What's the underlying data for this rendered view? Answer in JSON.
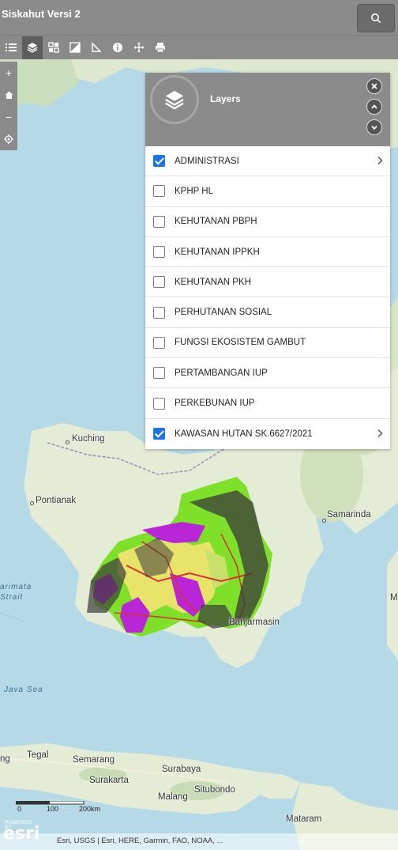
{
  "header": {
    "title": "Siskahut Versi 2",
    "search_icon": "search-icon"
  },
  "toolbar": {
    "tools": [
      "list-icon",
      "layers-icon",
      "basemap-icon",
      "overview-icon",
      "measure-icon",
      "info-icon",
      "move-icon",
      "print-icon"
    ],
    "active": "layers-icon"
  },
  "zoom": {
    "plus": "+",
    "minus": "−"
  },
  "layers_panel": {
    "title": "Layers",
    "items": [
      {
        "label": "ADMINISTRASI",
        "checked": true,
        "has_sub": true
      },
      {
        "label": "KPHP HL",
        "checked": false,
        "has_sub": false
      },
      {
        "label": "KEHUTANAN PBPH",
        "checked": false,
        "has_sub": false
      },
      {
        "label": "KEHUTANAN IPPKH",
        "checked": false,
        "has_sub": false
      },
      {
        "label": "KEHUTANAN PKH",
        "checked": false,
        "has_sub": false
      },
      {
        "label": "PERHUTANAN SOSIAL",
        "checked": false,
        "has_sub": false
      },
      {
        "label": "FUNGSI EKOSISTEM GAMBUT",
        "checked": false,
        "has_sub": false
      },
      {
        "label": "PERTAMBANGAN IUP",
        "checked": false,
        "has_sub": false
      },
      {
        "label": "PERKEBUNAN IUP",
        "checked": false,
        "has_sub": false
      },
      {
        "label": "KAWASAN HUTAN SK.6627/2021",
        "checked": true,
        "has_sub": true
      }
    ]
  },
  "map_labels": {
    "kuching": "Kuching",
    "pontianak": "Pontianak",
    "samarinda": "Samarinda",
    "banjarmasin": "Banjarmasin",
    "karimata": "arimata",
    "strait": "Strait",
    "java_sea": "Java Sea",
    "tegal": "Tegal",
    "semarang": "Semarang",
    "surakarta": "Surakarta",
    "surabaya": "Surabaya",
    "situbondo": "Situbondo",
    "malang": "Malang",
    "mataram": "Mataram",
    "ng": "ng",
    "m_edge": "M"
  },
  "scale": {
    "t0": "0",
    "t1": "100",
    "t2": "200km"
  },
  "attribution": {
    "powered": "POWERED BY",
    "logo": "esri",
    "text": "Esri, USGS | Esri, HERE, Garmin, FAO, NOAA, ..."
  },
  "colors": {
    "header": "#8b8b8b",
    "sea": "#b6d9e8",
    "land": "#e4ecd6",
    "forest_green": "#7fe02a",
    "yellow": "#e8e46a",
    "magenta": "#b826d6",
    "checkbox": "#1a73e8"
  }
}
